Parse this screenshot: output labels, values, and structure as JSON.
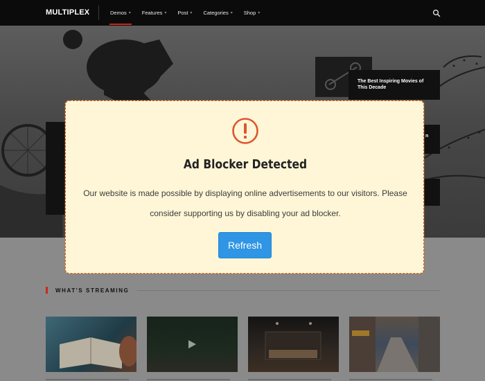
{
  "header": {
    "logo": "MULTIPLEX",
    "nav": [
      {
        "label": "Demos",
        "active": true
      },
      {
        "label": "Features",
        "active": false
      },
      {
        "label": "Post",
        "active": false
      },
      {
        "label": "Categories",
        "active": false
      },
      {
        "label": "Shop",
        "active": false
      }
    ],
    "search_icon": "search-icon",
    "accent_color": "#d3211c"
  },
  "hero": {
    "side_cards": [
      {
        "title": "The Best Inspiring Movies of This Decade"
      },
      {
        "title": "n"
      }
    ]
  },
  "streaming": {
    "title": "WHAT'S STREAMING"
  },
  "modal": {
    "icon": "exclamation-circle-icon",
    "title": "Ad Blocker Detected",
    "message": "Our website is made possible by displaying online advertisements to our visitors. Please consider supporting us by disabling your ad blocker.",
    "button_label": "Refresh",
    "colors": {
      "background": "#fef6d7",
      "border": "#c8672a",
      "icon": "#e0542d",
      "button": "#2f95e4"
    }
  }
}
